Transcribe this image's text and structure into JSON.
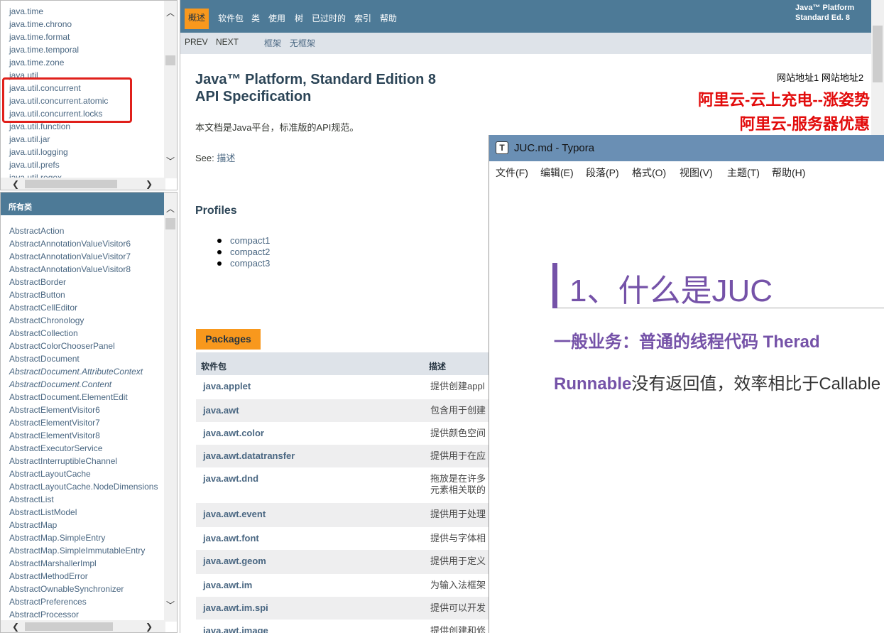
{
  "package_frame": {
    "packages": [
      "java.time",
      "java.time.chrono",
      "java.time.format",
      "java.time.temporal",
      "java.time.zone",
      "java.util",
      "java.util.concurrent",
      "java.util.concurrent.atomic",
      "java.util.concurrent.locks",
      "java.util.function",
      "java.util.jar",
      "java.util.logging",
      "java.util.prefs",
      "java.util.regex"
    ]
  },
  "class_frame": {
    "header": "所有类",
    "classes": [
      {
        "name": "AbstractAction"
      },
      {
        "name": "AbstractAnnotationValueVisitor6"
      },
      {
        "name": "AbstractAnnotationValueVisitor7"
      },
      {
        "name": "AbstractAnnotationValueVisitor8"
      },
      {
        "name": "AbstractBorder"
      },
      {
        "name": "AbstractButton"
      },
      {
        "name": "AbstractCellEditor"
      },
      {
        "name": "AbstractChronology"
      },
      {
        "name": "AbstractCollection"
      },
      {
        "name": "AbstractColorChooserPanel"
      },
      {
        "name": "AbstractDocument"
      },
      {
        "name": "AbstractDocument.AttributeContext",
        "italic": true
      },
      {
        "name": "AbstractDocument.Content",
        "italic": true
      },
      {
        "name": "AbstractDocument.ElementEdit"
      },
      {
        "name": "AbstractElementVisitor6"
      },
      {
        "name": "AbstractElementVisitor7"
      },
      {
        "name": "AbstractElementVisitor8"
      },
      {
        "name": "AbstractExecutorService"
      },
      {
        "name": "AbstractInterruptibleChannel"
      },
      {
        "name": "AbstractLayoutCache"
      },
      {
        "name": "AbstractLayoutCache.NodeDimensions"
      },
      {
        "name": "AbstractList"
      },
      {
        "name": "AbstractListModel"
      },
      {
        "name": "AbstractMap"
      },
      {
        "name": "AbstractMap.SimpleEntry"
      },
      {
        "name": "AbstractMap.SimpleImmutableEntry"
      },
      {
        "name": "AbstractMarshallerImpl"
      },
      {
        "name": "AbstractMethodError"
      },
      {
        "name": "AbstractOwnableSynchronizer"
      },
      {
        "name": "AbstractPreferences"
      },
      {
        "name": "AbstractProcessor"
      }
    ]
  },
  "main_frame": {
    "nav": {
      "overview": "概述",
      "items": [
        "软件包",
        "类",
        "使用",
        "树",
        "已过时的",
        "索引",
        "帮助"
      ],
      "platform_line1": "Java™ Platform",
      "platform_line2": "Standard Ed. 8"
    },
    "subnav": {
      "prev": "PREV",
      "next": "NEXT",
      "frames": "框架",
      "no_frames": "无框架"
    },
    "title_line1": "Java™ Platform, Standard Edition 8",
    "title_line2": "API Specification",
    "site_links": "网站地址1 网站地址2",
    "promo1": "阿里云-云上充电--涨姿势",
    "promo2": "阿里云-服务器优惠",
    "description": "本文档是Java平台，标准版的API规范。",
    "see_label": "See:",
    "see_link": "描述",
    "profiles_heading": "Profiles",
    "profiles": [
      "compact1",
      "compact2",
      "compact3"
    ],
    "packages_caption": "Packages",
    "table_header": {
      "name": "软件包",
      "desc": "描述"
    },
    "package_rows": [
      {
        "name": "java.applet",
        "desc": "提供创建appl"
      },
      {
        "name": "java.awt",
        "desc": "包含用于创建"
      },
      {
        "name": "java.awt.color",
        "desc": "提供颜色空间"
      },
      {
        "name": "java.awt.datatransfer",
        "desc": "提供用于在应"
      },
      {
        "name": "java.awt.dnd",
        "desc": "拖放是在许多",
        "desc2": "元素相关联的"
      },
      {
        "name": "java.awt.event",
        "desc": "提供用于处理"
      },
      {
        "name": "java.awt.font",
        "desc": "提供与字体相"
      },
      {
        "name": "java.awt.geom",
        "desc": "提供用于定义"
      },
      {
        "name": "java.awt.im",
        "desc": "为输入法框架"
      },
      {
        "name": "java.awt.im.spi",
        "desc": "提供可以开发"
      },
      {
        "name": "java.awt.image",
        "desc": "提供创建和修"
      }
    ]
  },
  "typora": {
    "window_title": "JUC.md - Typora",
    "app_icon_letter": "T",
    "menu": [
      "文件(F)",
      "编辑(E)",
      "段落(P)",
      "格式(O)",
      "视图(V)",
      "主题(T)",
      "帮助(H)"
    ],
    "h1": "1、什么是JUC",
    "h2": "一般业务：普通的线程代码 Therad",
    "p_bold": "Runnable",
    "p_text": "没有返回值，效率相比于Callable"
  },
  "colors": {
    "nav_bg": "#4d7a97",
    "accent_orange": "#f8981d",
    "link": "#4a6782",
    "promo_red": "#e20b0b",
    "typora_purple": "#7552a8",
    "highlight_box": "#e0201b"
  }
}
